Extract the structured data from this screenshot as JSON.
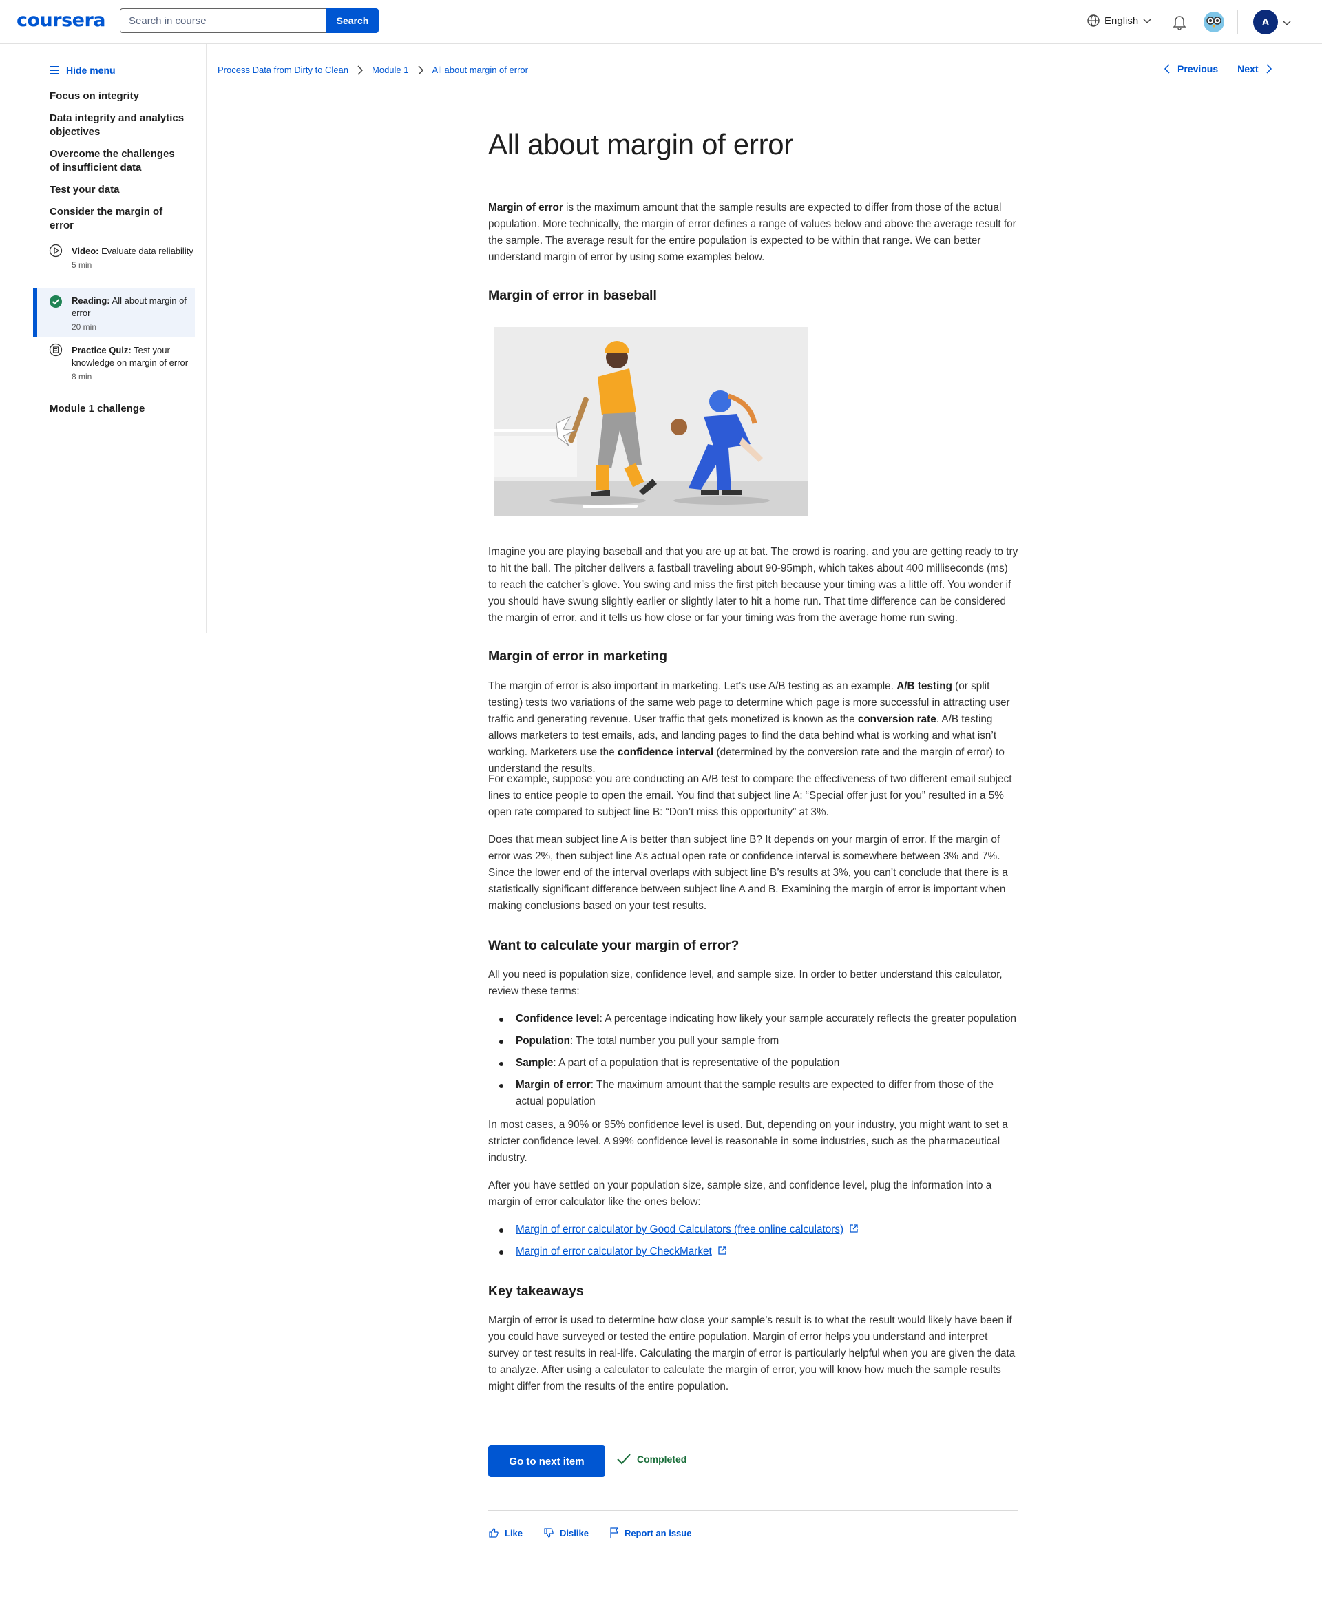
{
  "header": {
    "logo": "coursera",
    "search_placeholder": "Search in course",
    "search_button": "Search",
    "language": "English",
    "avatar_initial": "A"
  },
  "sidebar": {
    "hide_menu": "Hide menu",
    "sections": [
      "Focus on integrity",
      "Data integrity and analytics objectives",
      "Overcome the challenges of insufficient data",
      "Test your data",
      "Consider the margin of error"
    ],
    "items": [
      {
        "type": "Video:",
        "title": "Evaluate data reliability",
        "meta": "5 min"
      },
      {
        "type": "Reading:",
        "title": "All about margin of error",
        "meta": "20 min"
      },
      {
        "type": "Practice Quiz:",
        "title": "Test your knowledge on margin of error",
        "meta": "8 min"
      }
    ],
    "module_challenge": "Module 1 challenge"
  },
  "breadcrumb": [
    "Process Data from Dirty to Clean",
    "Module 1",
    "All about margin of error"
  ],
  "nav": {
    "previous": "Previous",
    "next": "Next"
  },
  "article": {
    "title": "All about margin of error",
    "intro_bold": "Margin of error",
    "intro_rest": " is the maximum amount that the sample results are expected to differ from those of the actual population. More technically, the margin of error defines a range of values below and above the average result for the sample. The average result for the entire population is expected to be within that range. We can better understand margin of error by using some examples below.",
    "h_baseball": "Margin of error in baseball",
    "p_baseball": "Imagine you are playing baseball and that you are up at bat. The crowd is roaring, and you are getting ready to try to hit the ball. The pitcher delivers a fastball traveling about 90-95mph, which takes about 400 milliseconds (ms) to reach the catcher’s glove. You swing and miss the first pitch because your timing was a little off. You wonder if you should have swung slightly earlier or slightly later to hit a home run. That time difference can be considered the margin of error, and it tells us how close or far your timing was from the average home run swing.",
    "h_marketing": "Margin of error in marketing",
    "mk1_a": "The margin of error is also important in marketing. Let’s use A/B testing as an example. ",
    "mk1_b": "A/B testing",
    "mk1_c": " (or split testing) tests two variations of the same web page to determine which page is more successful in attracting user traffic and generating revenue. User traffic that gets monetized is known as the ",
    "mk1_d": "conversion rate",
    "mk1_e": ". A/B testing allows marketers to test emails, ads, and landing pages to find the data behind what is working and what isn’t working. Marketers use the ",
    "mk1_f": "confidence interval",
    "mk1_g": " (determined by the conversion rate and the margin of error) to understand the results.",
    "mk2": "For example, suppose you are conducting an A/B test to compare the effectiveness of two different email subject lines to entice people to open the email. You find that subject line A: “Special offer just for you” resulted in a 5% open rate compared to subject line B: “Don’t miss this opportunity” at 3%.",
    "mk3": "Does that mean subject line A is better than subject line B? It depends on your margin of error. If the margin of error was 2%, then subject line A’s actual open rate or confidence interval is somewhere between 3% and 7%. Since the lower end of the interval overlaps with subject line B’s results at 3%, you can’t conclude that there is a statistically significant difference between subject line A and B. Examining the margin of error is important when making conclusions based on your test results.",
    "h_calc": "Want to calculate your margin of error?",
    "calc_intro": "All you need is population size, confidence level, and sample size. In order to better understand this calculator, review these terms:",
    "terms": [
      {
        "term": "Confidence level",
        "def": ": A percentage indicating how likely your sample accurately reflects the greater population"
      },
      {
        "term": "Population",
        "def": ": The total number you pull your sample from"
      },
      {
        "term": "Sample",
        "def": ": A part of a population that is representative of the population"
      },
      {
        "term": "Margin of error",
        "def": ": The maximum amount that the sample results are expected to differ from those of the actual population"
      }
    ],
    "calc_p2": "In most cases, a 90% or 95% confidence level is used. But, depending on your industry, you might want to set a stricter confidence level. A 99% confidence level is reasonable in some industries, such as the pharmaceutical industry.",
    "calc_p3": "After you have settled on your population size, sample size, and confidence level, plug the information into a margin of error calculator like the ones below:",
    "links": [
      "Margin of error calculator by Good Calculators (free online calculators)",
      "Margin of error calculator by CheckMarket"
    ],
    "h_takeaways": "Key takeaways",
    "takeaways": "Margin of error is used to determine how close your sample’s result is to what the result would likely have been if you could have surveyed or tested the entire population. Margin of error helps you understand and interpret survey or test results in real-life.  Calculating the margin of error is particularly helpful when you are given the data to analyze. After using a calculator to calculate the margin of error, you will know how much the sample results might differ from the results of the entire population."
  },
  "footer": {
    "next_item": "Go to next item",
    "completed": "Completed",
    "like": "Like",
    "dislike": "Dislike",
    "report": "Report an issue"
  },
  "colors": {
    "brand": "#0056d2",
    "completed": "#1a6e3a"
  }
}
